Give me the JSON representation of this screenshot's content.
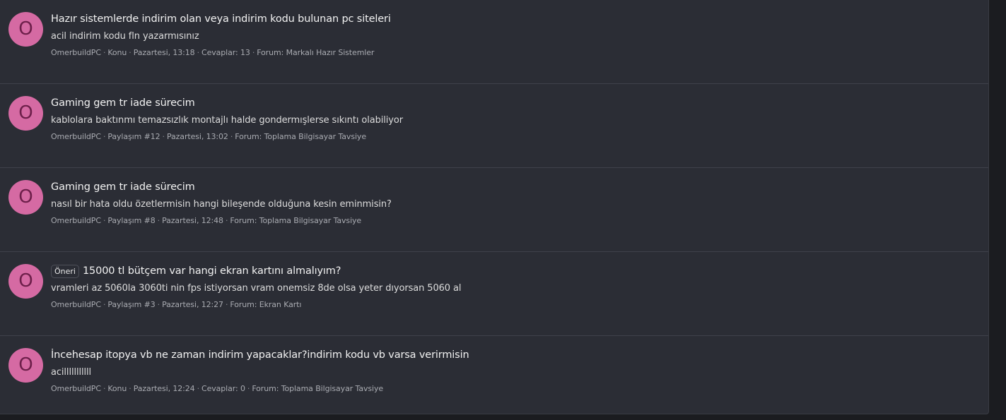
{
  "results": [
    {
      "avatar_letter": "O",
      "label": "",
      "title": "Hazır sistemlerde indirim olan veya indirim kodu bulunan pc siteleri",
      "snippet": "acil indirim kodu fln yazarmısınız",
      "author": "OmerbuildPC",
      "type": "Konu",
      "date": "Pazartesi, 13:18",
      "extra": "Cevaplar: 13",
      "forum": "Forum: Markalı Hazır Sistemler"
    },
    {
      "avatar_letter": "O",
      "label": "",
      "title": "Gaming gem tr iade sürecim",
      "snippet": "kablolara baktınmı temazsızlık montajlı halde gondermışlerse sıkıntı olabiliyor",
      "author": "OmerbuildPC",
      "type": "Paylaşım #12",
      "date": "Pazartesi, 13:02",
      "extra": "",
      "forum": "Forum: Toplama Bilgisayar Tavsiye"
    },
    {
      "avatar_letter": "O",
      "label": "",
      "title": "Gaming gem tr iade sürecim",
      "snippet": "nasıl bir hata oldu özetlermisin hangi bileşende olduğuna kesin eminmisin?",
      "author": "OmerbuildPC",
      "type": "Paylaşım #8",
      "date": "Pazartesi, 12:48",
      "extra": "",
      "forum": "Forum: Toplama Bilgisayar Tavsiye"
    },
    {
      "avatar_letter": "O",
      "label": "Öneri",
      "title": "15000 tl bütçem var hangi ekran kartını almalıyım?",
      "snippet": "vramleri az 5060la 3060ti nin fps istiyorsan vram onemsiz 8de olsa yeter dıyorsan 5060 al",
      "author": "OmerbuildPC",
      "type": "Paylaşım #3",
      "date": "Pazartesi, 12:27",
      "extra": "",
      "forum": "Forum: Ekran Kartı"
    },
    {
      "avatar_letter": "O",
      "label": "",
      "title": "İncehesap itopya vb ne zaman indirim yapacaklar?indirim kodu vb varsa verirmisin",
      "snippet": "acilllllllllll",
      "author": "OmerbuildPC",
      "type": "Konu",
      "date": "Pazartesi, 12:24",
      "extra": "Cevaplar: 0",
      "forum": "Forum: Toplama Bilgisayar Tavsiye"
    }
  ],
  "separator": "·",
  "colors": {
    "panel_bg": "#2b2d35",
    "avatar_bg": "#d56aa3",
    "avatar_letter": "#6d1f4a",
    "divider": "#40424b"
  }
}
